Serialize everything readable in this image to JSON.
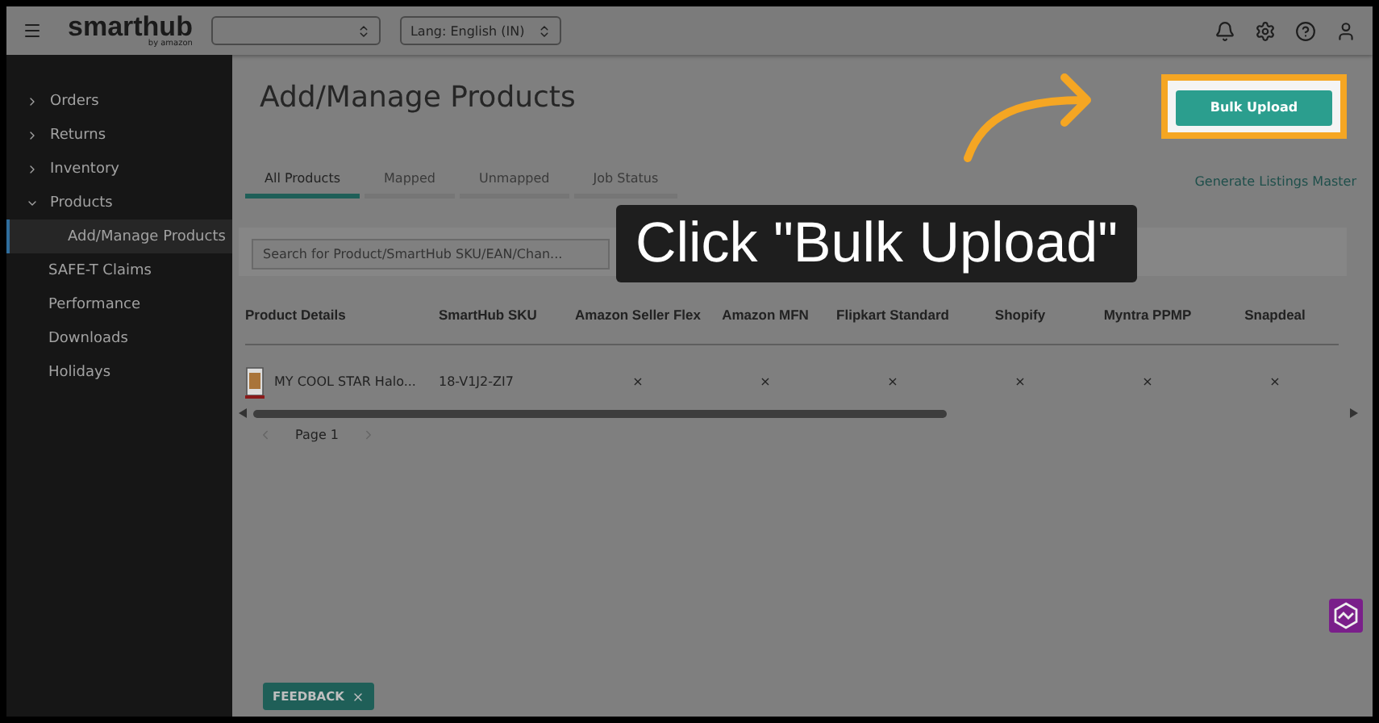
{
  "header": {
    "logo": {
      "name": "smarthub",
      "tagline": "by amazon"
    },
    "language_selector": {
      "value": "Lang: English (IN)"
    }
  },
  "sidebar": {
    "items": [
      {
        "label": "Orders",
        "kind": "group",
        "expanded": false,
        "selected": false
      },
      {
        "label": "Returns",
        "kind": "group",
        "expanded": false,
        "selected": false
      },
      {
        "label": "Inventory",
        "kind": "group",
        "expanded": false,
        "selected": false
      },
      {
        "label": "Products",
        "kind": "group",
        "expanded": true,
        "selected": false,
        "children": [
          {
            "label": "Add/Manage Products",
            "kind": "link",
            "selected": true
          }
        ]
      },
      {
        "label": "SAFE-T Claims",
        "kind": "link",
        "selected": false
      },
      {
        "label": "Performance",
        "kind": "link",
        "selected": false
      },
      {
        "label": "Downloads",
        "kind": "link",
        "selected": false
      },
      {
        "label": "Holidays",
        "kind": "link",
        "selected": false
      }
    ]
  },
  "page": {
    "title": "Add/Manage Products",
    "bulk_upload_button": "Bulk Upload",
    "tabs": [
      {
        "label": "All Products",
        "selected": true
      },
      {
        "label": "Mapped",
        "selected": false
      },
      {
        "label": "Unmapped",
        "selected": false
      },
      {
        "label": "Job Status",
        "selected": false
      }
    ],
    "generate_link": "Generate Listings Master",
    "search": {
      "placeholder": "Search for Product/SmartHub SKU/EAN/Chan..."
    },
    "table": {
      "columns": [
        "Product Details",
        "SmartHub SKU",
        "Amazon Seller Flex",
        "Amazon MFN",
        "Flipkart Standard",
        "Shopify",
        "Myntra PPMP",
        "Snapdeal"
      ],
      "rows": [
        {
          "cells": [
            "MY COOL STAR Halo...",
            "18-V1J2-ZI7",
            "×",
            "×",
            "×",
            "×",
            "×",
            "×"
          ]
        }
      ]
    },
    "pagination": {
      "page": "Page 1"
    },
    "feedback": "FEEDBACK"
  },
  "callout": "Click \"Bulk Upload\""
}
